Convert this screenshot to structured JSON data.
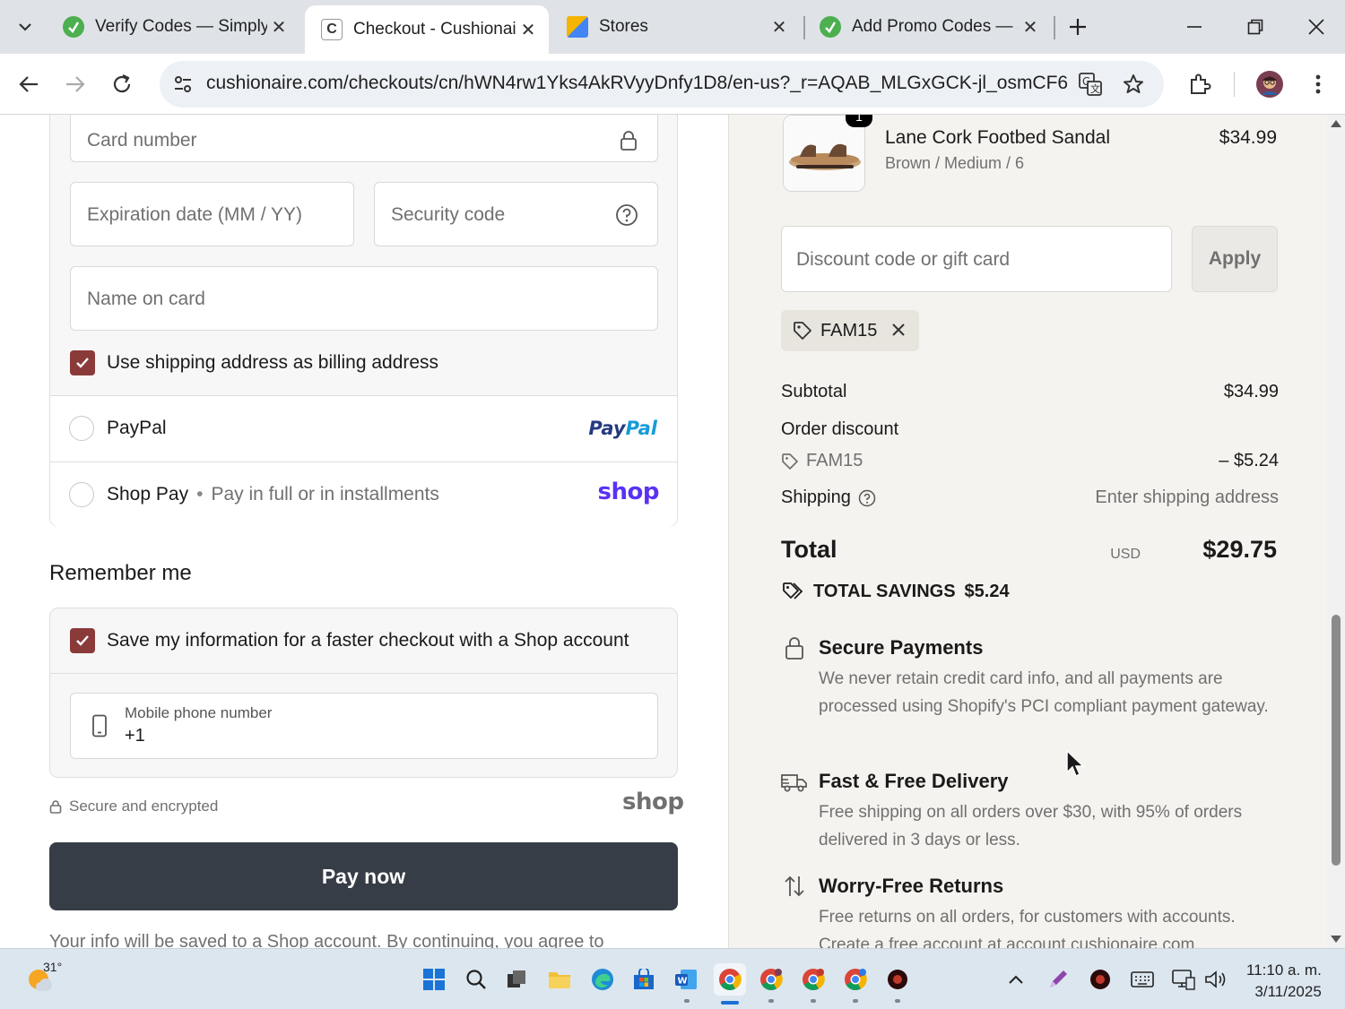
{
  "browser": {
    "tabs": [
      {
        "label": "Verify Codes — Simply",
        "favicon": "simplycodes-icon",
        "active": false
      },
      {
        "label": "Checkout - Cushionaire",
        "favicon": "cushionaire-icon",
        "active": true
      },
      {
        "label": "Stores",
        "favicon": "stores-icon",
        "active": false
      },
      {
        "label": "Add Promo Codes — S",
        "favicon": "simplycodes-icon",
        "active": false
      }
    ],
    "url": "cushionaire.com/checkouts/cn/hWN4rw1Yks4AkRVyyDnfy1D8/en-us?_r=AQAB_MLGxGCK-jl_osmCF6PF..."
  },
  "payment": {
    "card_number_placeholder": "Card number",
    "expiration_placeholder": "Expiration date (MM / YY)",
    "security_code_placeholder": "Security code",
    "name_on_card_placeholder": "Name on card",
    "billing_checkbox_label": "Use shipping address as billing address",
    "paypal_label": "PayPal",
    "paypal_logo": "PayPal",
    "shoppay_label": "Shop Pay",
    "shoppay_sub": "Pay in full or in installments",
    "shop_logo": "shop"
  },
  "remember": {
    "title": "Remember me",
    "save_label": "Save my information for a faster checkout with a Shop account",
    "phone_label": "Mobile phone number",
    "phone_value": "+1"
  },
  "secure_note": "Secure and encrypted",
  "shop_logo_footer": "shop",
  "pay_now_label": "Pay now",
  "footer_text": "Your info will be saved to a Shop account. By continuing, you agree to",
  "order": {
    "product_name": "Lane Cork Footbed Sandal",
    "product_variant": "Brown / Medium / 6",
    "product_price": "$34.99",
    "quantity": "1",
    "discount_placeholder": "Discount code or gift card",
    "apply_label": "Apply",
    "applied_code": "FAM15",
    "subtotal_label": "Subtotal",
    "subtotal_value": "$34.99",
    "discount_label": "Order discount",
    "discount_code": "FAM15",
    "discount_value": "– $5.24",
    "shipping_label": "Shipping",
    "shipping_value": "Enter shipping address",
    "total_label": "Total",
    "total_currency": "USD",
    "total_value": "$29.75",
    "savings_label": "TOTAL SAVINGS",
    "savings_value": "$5.24"
  },
  "features": [
    {
      "title": "Secure Payments",
      "desc": "We never retain credit card info, and all payments are processed using Shopify's PCI compliant payment gateway.",
      "icon": "lock-icon"
    },
    {
      "title": "Fast & Free Delivery",
      "desc": "Free shipping on all orders over $30, with 95% of orders delivered in 3 days or less.",
      "icon": "truck-icon"
    },
    {
      "title": "Worry-Free Returns",
      "desc": "Free returns on all orders, for customers with accounts. Create a free account at account.cushionaire.com.",
      "icon": "arrows-updown-icon"
    }
  ],
  "taskbar": {
    "temperature": "31°",
    "time": "11:10 a. m.",
    "date": "3/11/2025"
  },
  "colors": {
    "checkbox": "#8b3a3a",
    "pay_button": "#373d47",
    "shop_purple": "#5a31f4",
    "paypal_blue": "#253b80",
    "paypal_light": "#179bd7"
  }
}
